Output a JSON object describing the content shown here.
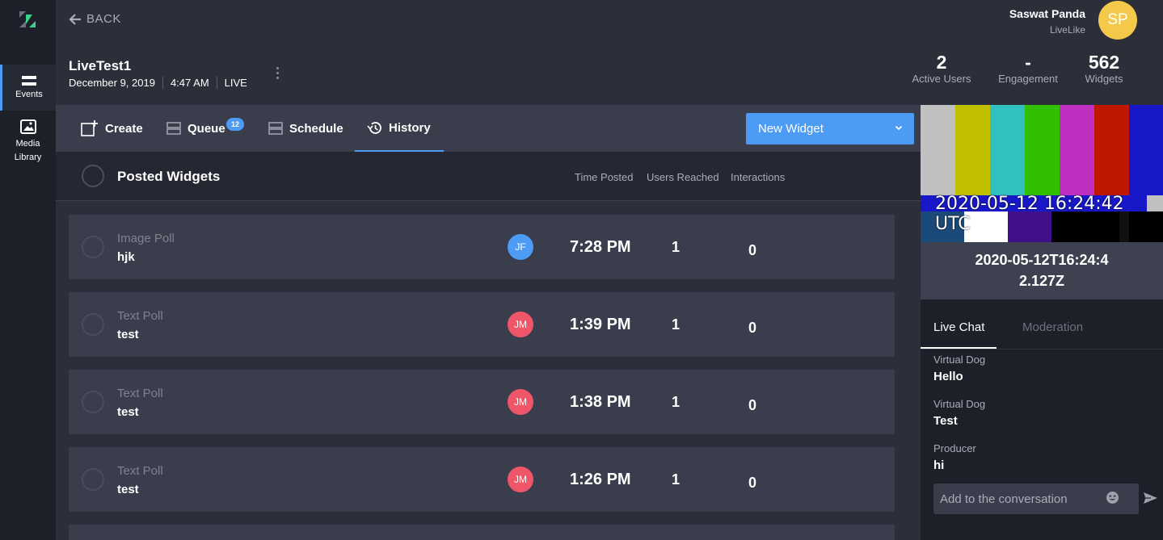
{
  "rail": {
    "items": [
      {
        "label": "Events"
      },
      {
        "label": "Media Library"
      }
    ]
  },
  "header": {
    "back_label": "BACK",
    "event_title": "LiveTest1",
    "event_date": "December 9, 2019",
    "event_time": "4:47 AM",
    "event_status": "LIVE"
  },
  "user": {
    "name": "Saswat Panda",
    "org": "LiveLike",
    "initials": "SP",
    "avatar_color": "#f4c94a"
  },
  "stats": [
    {
      "value": "2",
      "label": "Active Users"
    },
    {
      "value": "-",
      "label": "Engagement"
    },
    {
      "value": "562",
      "label": "Widgets"
    }
  ],
  "toolbar": {
    "tabs": [
      {
        "label": "Create",
        "icon": "add-widget-icon"
      },
      {
        "label": "Queue",
        "icon": "queue-icon",
        "badge": "12"
      },
      {
        "label": "Schedule",
        "icon": "schedule-icon"
      },
      {
        "label": "History",
        "icon": "history-icon",
        "active": true
      }
    ],
    "new_widget_label": "New Widget"
  },
  "list": {
    "title": "Posted Widgets",
    "columns": [
      "Time Posted",
      "Users Reached",
      "Interactions"
    ],
    "rows": [
      {
        "type": "Image Poll",
        "name": "hjk",
        "initials": "JF",
        "avatar_color": "#4c9bf5",
        "time": "7:28 PM",
        "reached": "1",
        "interactions": "0"
      },
      {
        "type": "Text Poll",
        "name": "test",
        "initials": "JM",
        "avatar_color": "#f0566a",
        "time": "1:39 PM",
        "reached": "1",
        "interactions": "0"
      },
      {
        "type": "Text Poll",
        "name": "test",
        "initials": "JM",
        "avatar_color": "#f0566a",
        "time": "1:38 PM",
        "reached": "1",
        "interactions": "0"
      },
      {
        "type": "Text Poll",
        "name": "test",
        "initials": "JM",
        "avatar_color": "#f0566a",
        "time": "1:26 PM",
        "reached": "1",
        "interactions": "0"
      }
    ]
  },
  "video": {
    "overlay_timestamp": "2020-05-12 16:24:42 UTC",
    "timestamp": "2020-05-12T16:24:42.127Z"
  },
  "chat": {
    "tabs": [
      {
        "label": "Live Chat",
        "active": true
      },
      {
        "label": "Moderation"
      }
    ],
    "messages": [
      {
        "author": "Virtual Dog",
        "text": "Hello"
      },
      {
        "author": "Virtual Dog",
        "text": "Test"
      },
      {
        "author": "Producer",
        "text": "hi"
      }
    ],
    "input_placeholder": "Add to the conversation"
  }
}
